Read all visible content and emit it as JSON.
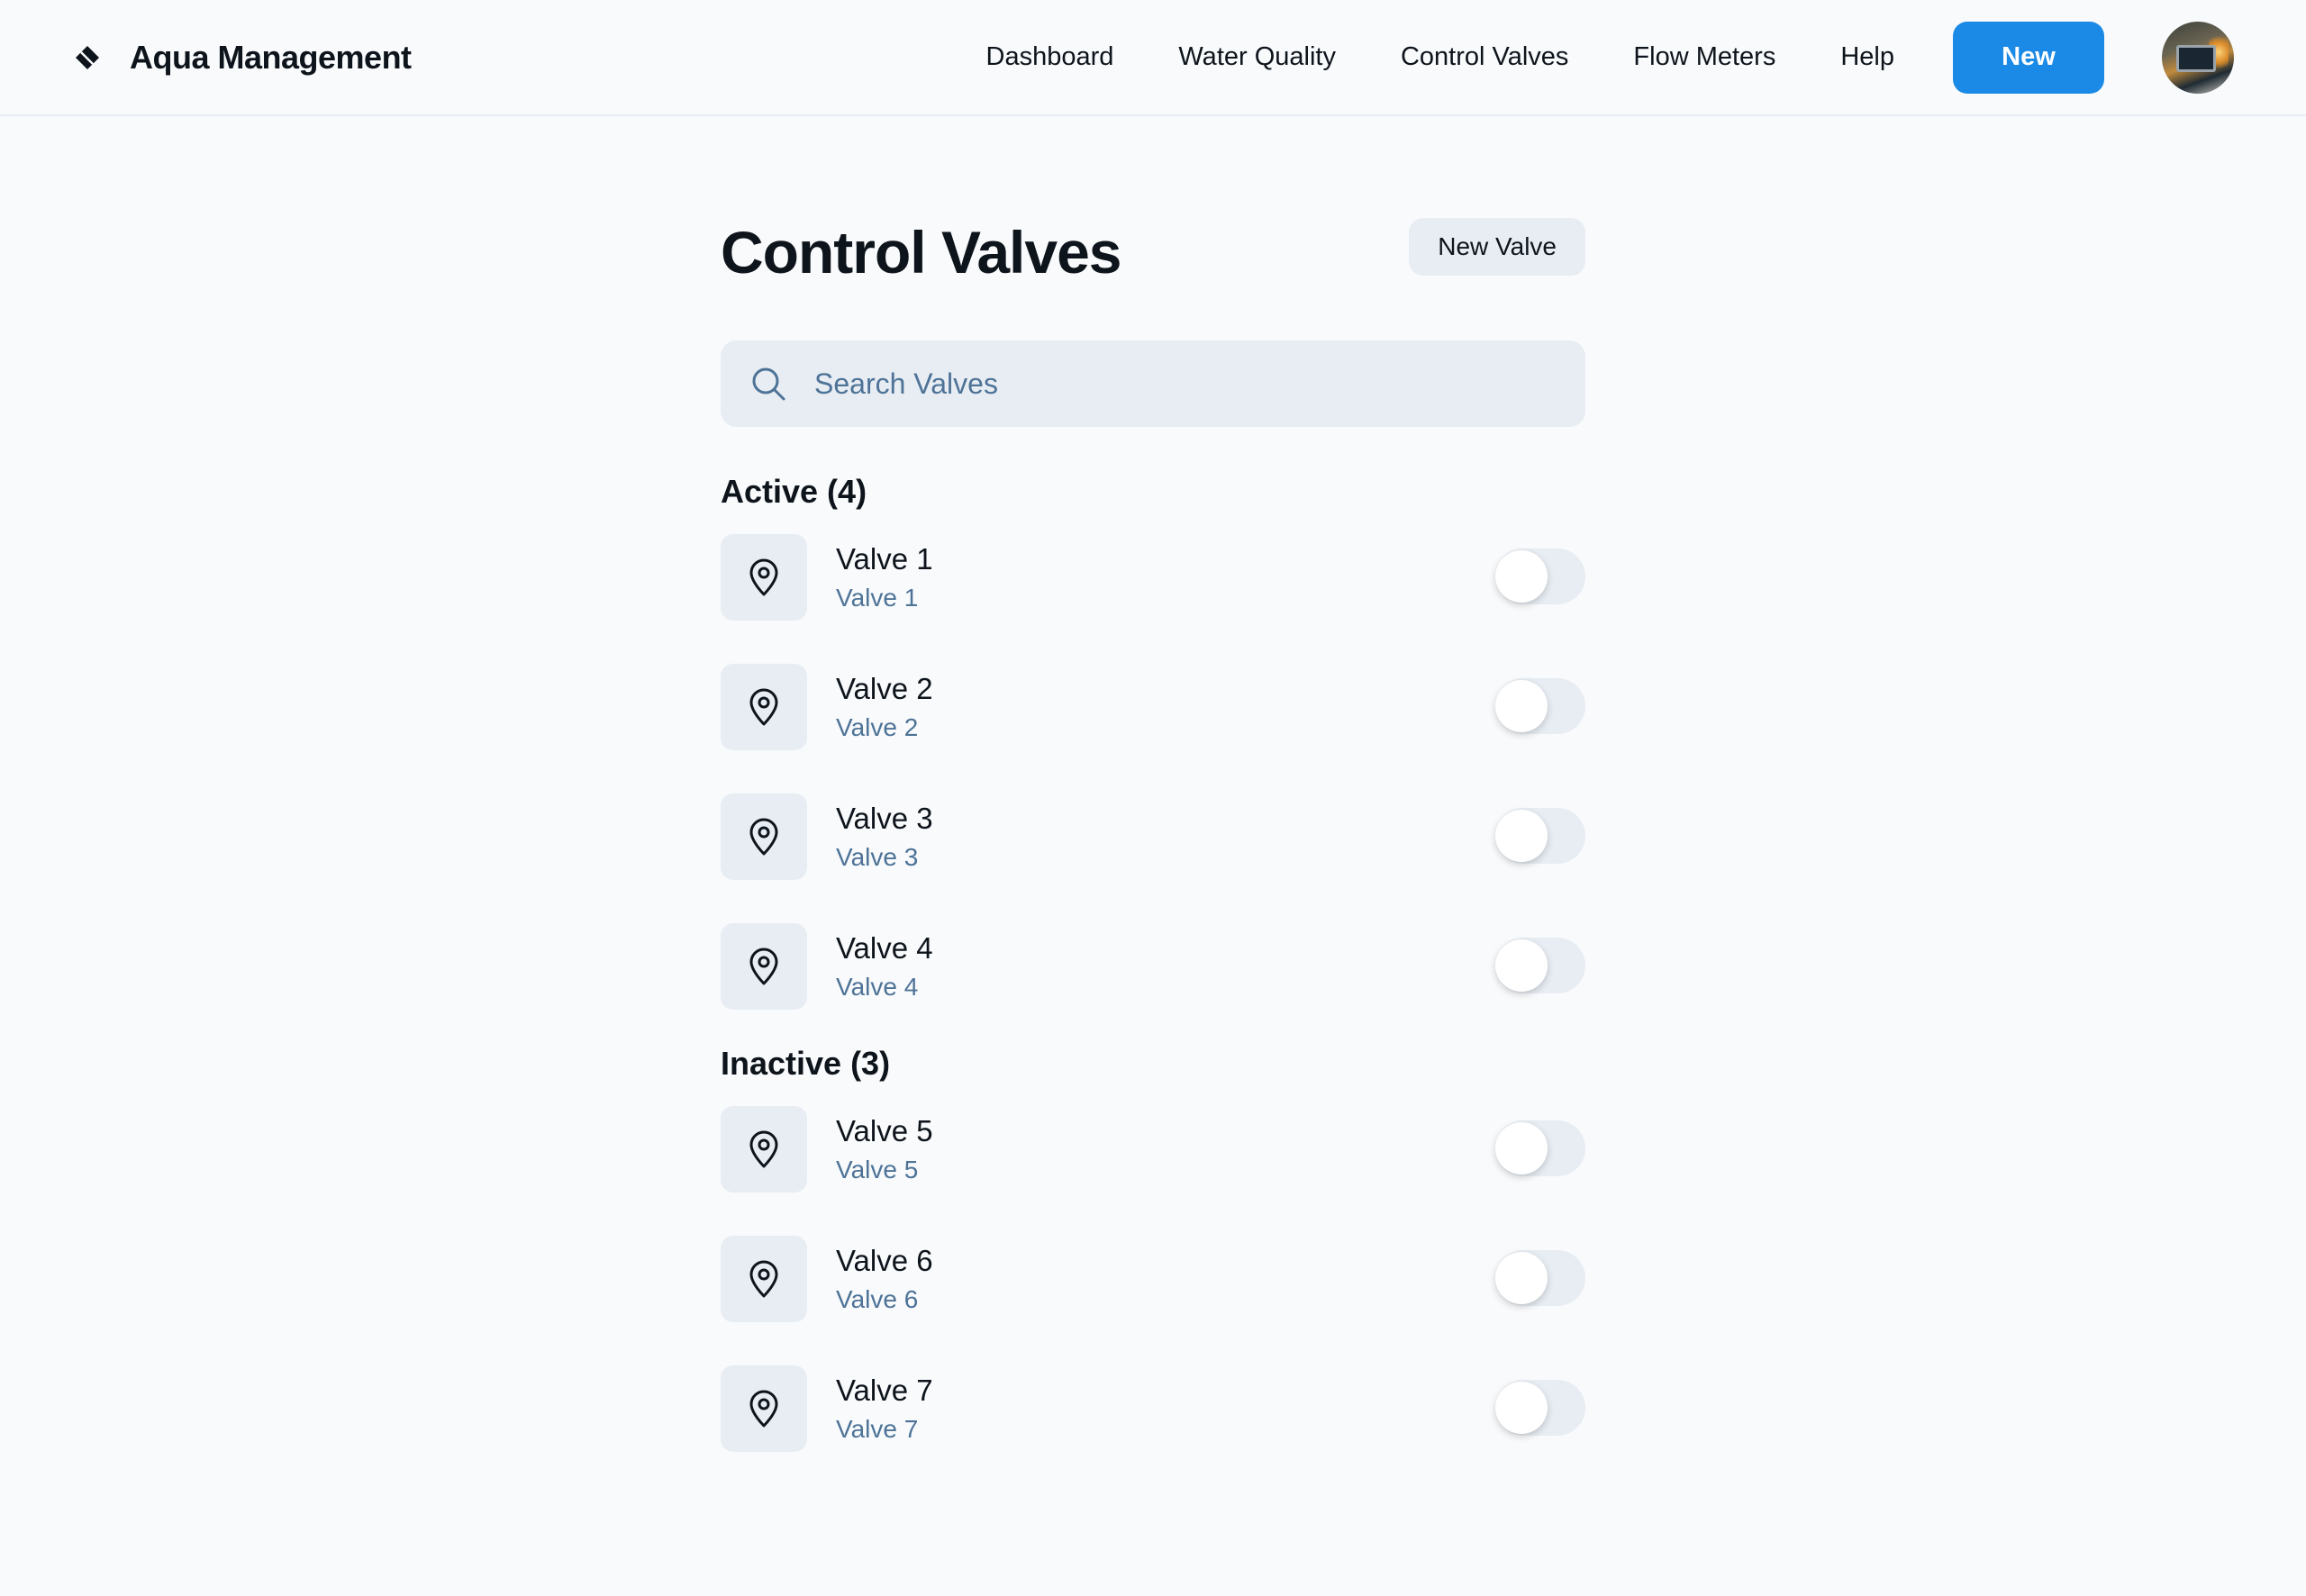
{
  "app": {
    "title": "Aqua Management",
    "logo_icon": "drop-diamond-icon"
  },
  "nav": {
    "items": [
      "Dashboard",
      "Water Quality",
      "Control Valves",
      "Flow Meters",
      "Help"
    ],
    "new_label": "New"
  },
  "page": {
    "title": "Control Valves",
    "new_valve_label": "New Valve",
    "search_placeholder": "Search Valves"
  },
  "sections": {
    "active": {
      "heading": "Active (4)",
      "items": [
        {
          "title": "Valve 1",
          "subtitle": "Valve 1",
          "icon": "map-pin-icon",
          "toggle_on": false
        },
        {
          "title": "Valve 2",
          "subtitle": "Valve 2",
          "icon": "map-pin-icon",
          "toggle_on": false
        },
        {
          "title": "Valve 3",
          "subtitle": "Valve 3",
          "icon": "map-pin-icon",
          "toggle_on": false
        },
        {
          "title": "Valve 4",
          "subtitle": "Valve 4",
          "icon": "map-pin-icon",
          "toggle_on": false
        }
      ]
    },
    "inactive": {
      "heading": "Inactive (3)",
      "items": [
        {
          "title": "Valve 5",
          "subtitle": "Valve 5",
          "icon": "map-pin-icon",
          "toggle_on": false
        },
        {
          "title": "Valve 6",
          "subtitle": "Valve 6",
          "icon": "map-pin-icon",
          "toggle_on": false
        },
        {
          "title": "Valve 7",
          "subtitle": "Valve 7",
          "icon": "map-pin-icon",
          "toggle_on": false
        }
      ]
    }
  },
  "colors": {
    "accent": "#1b8ae6",
    "background": "#f8fafc",
    "surface": "#e7edf3",
    "muted_text": "#4e7397",
    "text": "#0e141b"
  }
}
